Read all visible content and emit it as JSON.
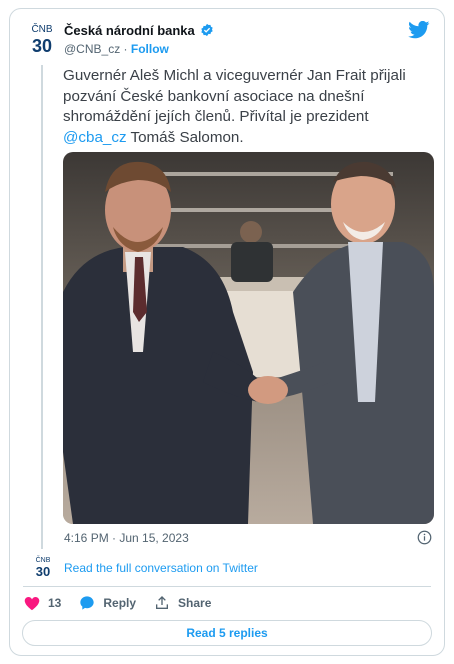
{
  "account": {
    "name": "Česká národní banka",
    "handle": "@CNB_cz",
    "separator": "·",
    "follow_label": "Follow",
    "logo_text_top": "ČNB",
    "logo_text_bottom": "30"
  },
  "tweet": {
    "text_part1": "Guvernér Aleš Michl a viceguvernér Jan Frait přijali pozvání České bankovní asociace na dnešní shromáždění jejích členů. Přivítal je prezident ",
    "mention": "@cba_cz",
    "text_part2": " Tomáš Salomon.",
    "timestamp": "4:16 PM · Jun 15, 2023",
    "image": {
      "description": "photo"
    }
  },
  "conversation_link": "Read the full conversation on Twitter",
  "actions": {
    "like_count": "13",
    "reply_label": "Reply",
    "share_label": "Share"
  },
  "read_replies_label": "Read 5 replies",
  "colors": {
    "accent": "#1d9bf0",
    "like": "#f91880",
    "border": "#cfd9de",
    "muted": "#536471"
  }
}
